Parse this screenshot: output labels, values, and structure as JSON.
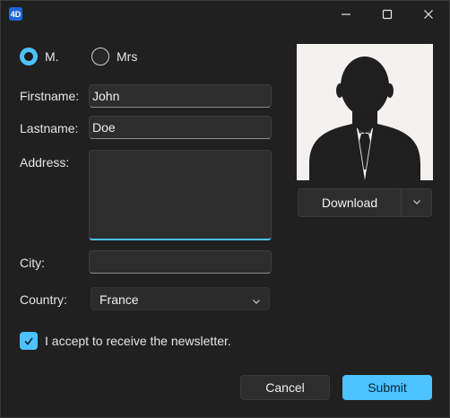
{
  "window": {
    "app_icon": "4d-app-icon",
    "controls": [
      "minimize-icon",
      "maximize-icon",
      "close-icon"
    ]
  },
  "title_radio": {
    "options": [
      {
        "label": "M.",
        "selected": true
      },
      {
        "label": "Mrs",
        "selected": false
      }
    ]
  },
  "form": {
    "firstname": {
      "label": "Firstname:",
      "value": "John"
    },
    "lastname": {
      "label": "Lastname:",
      "value": "Doe"
    },
    "address": {
      "label": "Address:",
      "value": ""
    },
    "city": {
      "label": "City:",
      "value": ""
    },
    "country": {
      "label": "Country:",
      "value": "France"
    }
  },
  "photo": {
    "icon": "person-silhouette-icon"
  },
  "download": {
    "label": "Download",
    "dropdown_icon": "chevron-down-icon"
  },
  "newsletter": {
    "label": "I accept to receive the newsletter.",
    "checked": true
  },
  "buttons": {
    "cancel": "Cancel",
    "submit": "Submit"
  },
  "colors": {
    "accent": "#4cc2ff",
    "background": "#202020",
    "field": "#2d2d2d"
  }
}
